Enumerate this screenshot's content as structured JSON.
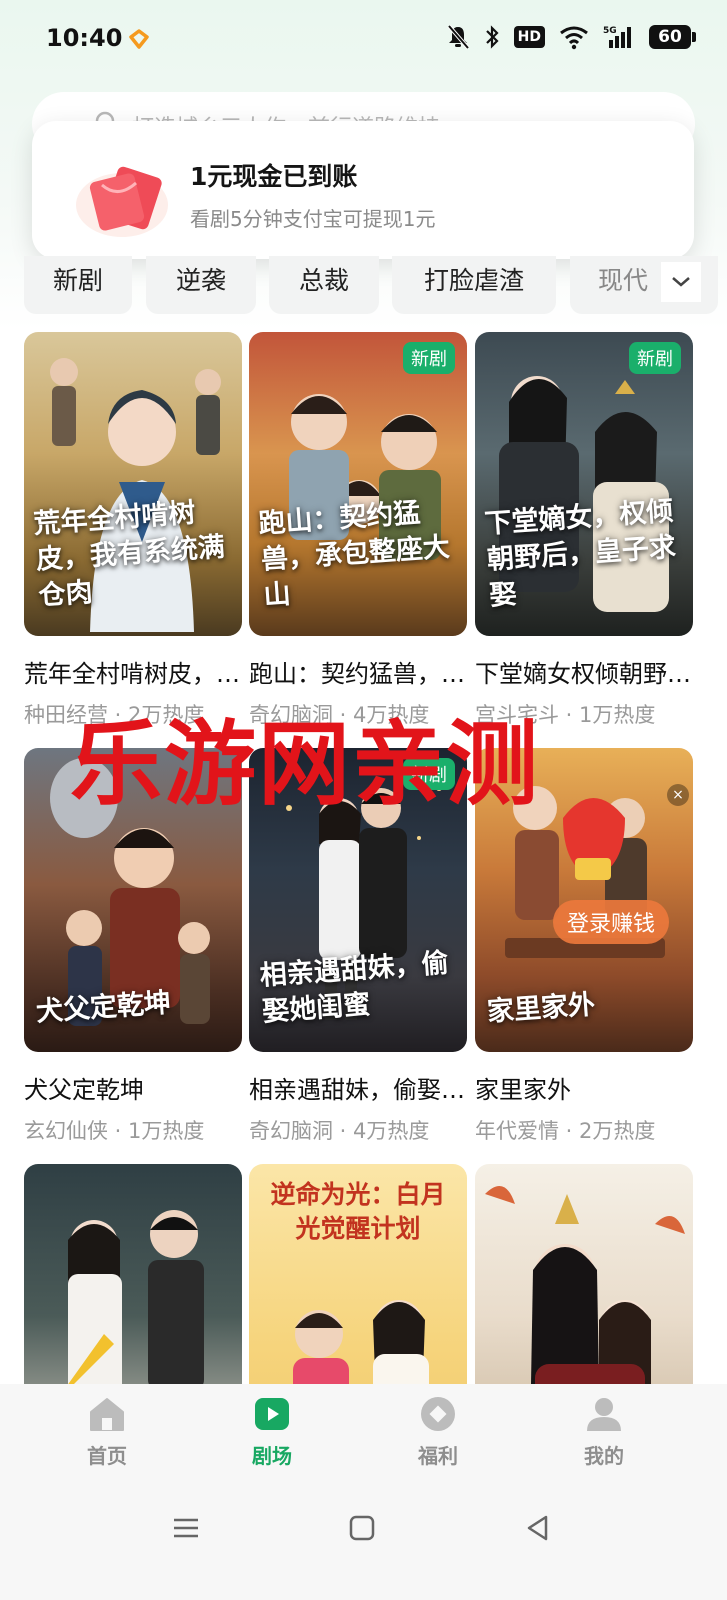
{
  "status_bar": {
    "time": "10:40",
    "battery": "60",
    "hd": "HD",
    "network": "5G"
  },
  "search": {
    "placeholder": "打造城乡三人作，前行道路维持"
  },
  "toast": {
    "title": "1元现金已到账",
    "subtitle": "看剧5分钟支付宝可提现1元"
  },
  "tabs": [
    "新剧",
    "逆袭",
    "总裁",
    "打脸虐渣",
    "现代"
  ],
  "badge_new": "新剧",
  "login_button": "登录赚钱",
  "watermark": "乐游网亲测",
  "cards": [
    {
      "title": "荒年全村啃树皮，我有系统满仓肉",
      "poster_text": "荒年全村啃树皮，我有系统满仓肉",
      "meta": "种田经营 · 2万热度",
      "new": false
    },
    {
      "title": "跑山：契约猛兽，承包整座大山",
      "poster_text": "跑山：契约猛兽，承包整座大山",
      "meta": "奇幻脑洞 · 4万热度",
      "new": true
    },
    {
      "title": "下堂嫡女权倾朝野后，皇子求娶",
      "poster_text": "下堂嫡女，权倾朝野后，皇子求娶",
      "meta": "宫斗宅斗 · 1万热度",
      "new": true
    },
    {
      "title": "犬父定乾坤",
      "poster_text": "犬父定乾坤",
      "meta": "玄幻仙侠 · 1万热度",
      "new": false
    },
    {
      "title": "相亲遇甜妹，偷娶她闺蜜",
      "poster_text": "相亲遇甜妹，偷娶她闺蜜",
      "meta": "奇幻脑洞 · 4万热度",
      "new": true
    },
    {
      "title": "家里家外",
      "poster_text": "家里家外",
      "meta": "年代爱情 · 2万热度",
      "new": false
    },
    {
      "title": "",
      "poster_text": "",
      "meta": "",
      "new": false
    },
    {
      "title": "",
      "poster_text": "逆命为光：白月光觉醒计划",
      "meta": "",
      "new": false
    },
    {
      "title": "",
      "poster_text": "",
      "meta": "",
      "new": false
    }
  ],
  "bottom_nav": [
    {
      "label": "首页",
      "icon": "home-icon"
    },
    {
      "label": "剧场",
      "icon": "play-icon"
    },
    {
      "label": "福利",
      "icon": "gift-icon"
    },
    {
      "label": "我的",
      "icon": "profile-icon"
    }
  ],
  "colors": {
    "accent": "#18a862",
    "badge": "#1aaf6b",
    "watermark": "#e2141a"
  }
}
